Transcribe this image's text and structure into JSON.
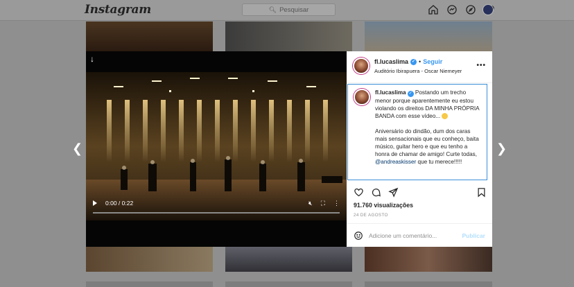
{
  "nav": {
    "logo": "Instagram",
    "search_placeholder": "Pesquisar",
    "icons": [
      "home-icon",
      "messenger-icon",
      "explore-icon",
      "heart-icon",
      "profile-avatar"
    ]
  },
  "post": {
    "username": "fl.lucaslima",
    "follow_label": "Seguir",
    "separator": "•",
    "location": "Auditório Ibirapuera - Oscar Niemeyer",
    "more_label": "•••",
    "caption_user": "fl.lucaslima",
    "caption_line1": " Postando um trecho menor porque aparentemente eu estou violando os direitos DA MINHA PRÓPRIA BANDA com esse vídeo... ",
    "caption_line2": "\n\nAniversário do dindão, dum dos caras mais sensacionais que eu conheço, baita músico, guitar hero e que eu tenho a honra de chamar de amigo! Curte todas, ",
    "caption_mention": "@andreaskisser",
    "caption_line3": " que tu merece!!!!!",
    "views": "91.760 visualizações",
    "date": "24 DE AGOSTO",
    "comment_placeholder": "Adicione um comentário...",
    "publish_label": "Publicar"
  },
  "video": {
    "time": "0:00 / 0:22",
    "progress": 0
  },
  "colors": {
    "accent": "#3897f0",
    "publish_disabled": "#b2dffc",
    "overlay_bg": "#8f8f8f"
  }
}
